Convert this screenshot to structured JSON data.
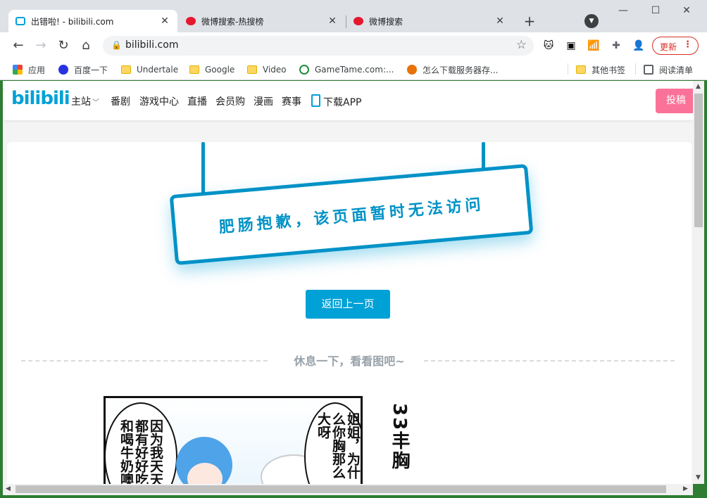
{
  "browser": {
    "tabs": [
      {
        "title": "出错啦! - bilibili.com",
        "active": true,
        "icon": "bilibili-tv-icon"
      },
      {
        "title": "微博搜索-热搜榜",
        "active": false,
        "icon": "weibo-icon"
      },
      {
        "title": "微博搜索",
        "active": false,
        "icon": "weibo-icon"
      }
    ],
    "new_tab": "+",
    "window_controls": [
      "—",
      "☐",
      "✕"
    ],
    "url": "bilibili.com",
    "update_label": "更新",
    "bookmarks": [
      {
        "label": "应用",
        "icon": "apps-grid-icon"
      },
      {
        "label": "百度一下",
        "icon": "baidu-paw-icon"
      },
      {
        "label": "Undertale",
        "icon": "folder-icon"
      },
      {
        "label": "Google",
        "icon": "folder-icon"
      },
      {
        "label": "Video",
        "icon": "folder-icon"
      },
      {
        "label": "GameTame.com:...",
        "icon": "gametame-icon"
      },
      {
        "label": "怎么下载服务器存...",
        "icon": "site-icon"
      }
    ],
    "other_bookmarks": "其他书签",
    "reading_list": "阅读清单"
  },
  "site": {
    "logo": "bilibili",
    "nav": [
      "主站",
      "番剧",
      "游戏中心",
      "直播",
      "会员购",
      "漫画",
      "赛事",
      "下载APP"
    ],
    "upload": "投稿"
  },
  "error": {
    "sign_text": "肥肠抱歉，该页面暂时无法访问",
    "back_button": "返回上一页",
    "rest_text": "休息一下，看看图吧~"
  },
  "comic": {
    "bubble1": [
      "因为我天天",
      "都有好好吃",
      "和喝牛奶噢"
    ],
    "bubble2": [
      "姐姐，为什么",
      "你胸那么大呀"
    ],
    "title": "33丰胸"
  },
  "colors": {
    "accent": "#00a1d6",
    "upload_pink": "#fb7299",
    "update_red": "#d93025"
  }
}
